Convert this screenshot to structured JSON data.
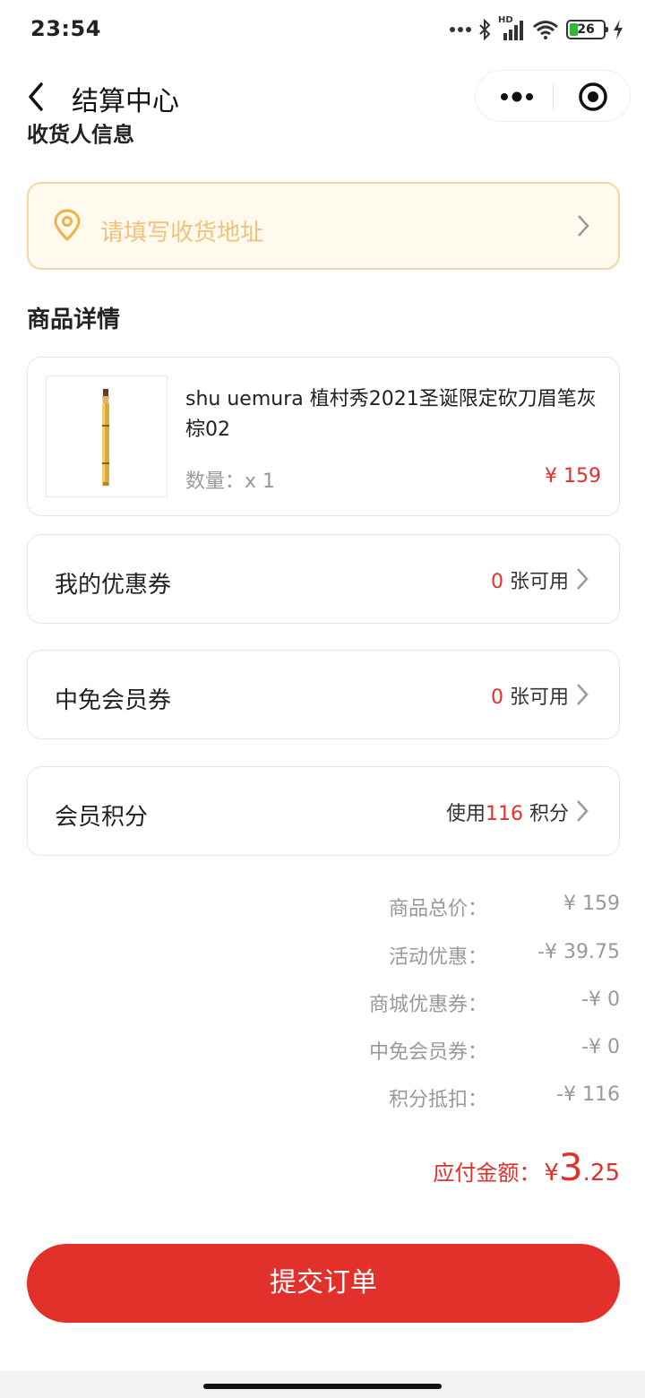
{
  "status_bar": {
    "time": "23:54",
    "battery_level": "26",
    "network_label": "HD",
    "icons": [
      "more-dots-icon",
      "bluetooth-icon",
      "signal-icon",
      "wifi-icon",
      "battery-icon",
      "charging-icon"
    ]
  },
  "nav": {
    "title": "结算中心",
    "back_icon": "chevron-left-icon",
    "capsule_icons": [
      "more-dots-icon",
      "target-icon"
    ]
  },
  "receiver": {
    "section_title": "收货人信息",
    "address_placeholder": "请填写收货地址"
  },
  "goods": {
    "section_title": "商品详情",
    "product": {
      "name": "shu uemura 植村秀2021圣诞限定砍刀眉笔灰棕02",
      "quantity_label": "数量：",
      "quantity_value": "x 1",
      "price": "¥ 159"
    }
  },
  "options": {
    "coupon": {
      "label": "我的优惠券",
      "count": "0",
      "suffix": " 张可用"
    },
    "member_coupon": {
      "label": "中免会员券",
      "count": "0",
      "suffix": " 张可用"
    },
    "points": {
      "label": "会员积分",
      "prefix": "使用",
      "count": "116",
      "suffix": " 积分"
    }
  },
  "summary": [
    {
      "label": "商品总价：",
      "value": "¥ 159"
    },
    {
      "label": "活动优惠：",
      "value": "-¥ 39.75"
    },
    {
      "label": "商城优惠券：",
      "value": "-¥ 0"
    },
    {
      "label": "中免会员券：",
      "value": "-¥ 0"
    },
    {
      "label": "积分抵扣：",
      "value": "-¥ 116"
    }
  ],
  "payable": {
    "label": "应付金额：",
    "currency": "¥",
    "integer": "3",
    "decimal": ".25"
  },
  "submit_label": "提交订单",
  "colors": {
    "accent": "#e2312b",
    "address_bg": "#fff9ee",
    "address_border": "#f5d6a0",
    "placeholder": "#f0c27a"
  }
}
